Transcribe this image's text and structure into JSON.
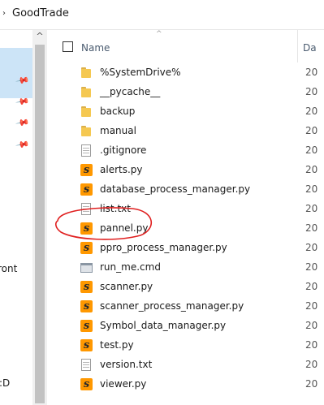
{
  "breadcrumb": {
    "chevron": "›",
    "folder": "GoodTrade"
  },
  "header": {
    "name_label": "Name",
    "date_label": "Da",
    "sort_arrow": "^"
  },
  "nav": {
    "scroll_up": "^",
    "partial_labels": [
      "ront",
      ":D"
    ]
  },
  "files": [
    {
      "name": "%SystemDrive%",
      "type": "folder",
      "date": "20"
    },
    {
      "name": "__pycache__",
      "type": "folder",
      "date": "20"
    },
    {
      "name": "backup",
      "type": "folder",
      "date": "20"
    },
    {
      "name": "manual",
      "type": "folder",
      "date": "20"
    },
    {
      "name": ".gitignore",
      "type": "text",
      "date": "20"
    },
    {
      "name": "alerts.py",
      "type": "python",
      "date": "20"
    },
    {
      "name": "database_process_manager.py",
      "type": "python",
      "date": "20"
    },
    {
      "name": "list.txt",
      "type": "text",
      "date": "20"
    },
    {
      "name": "pannel.py",
      "type": "python",
      "date": "20"
    },
    {
      "name": "ppro_process_manager.py",
      "type": "python",
      "date": "20"
    },
    {
      "name": "run_me.cmd",
      "type": "cmd",
      "date": "20"
    },
    {
      "name": "scanner.py",
      "type": "python",
      "date": "20"
    },
    {
      "name": "scanner_process_manager.py",
      "type": "python",
      "date": "20"
    },
    {
      "name": "Symbol_data_manager.py",
      "type": "python",
      "date": "20"
    },
    {
      "name": "test.py",
      "type": "python",
      "date": "20"
    },
    {
      "name": "version.txt",
      "type": "text",
      "date": "20"
    },
    {
      "name": "viewer.py",
      "type": "python",
      "date": "20"
    }
  ],
  "colors": {
    "annotation": "#e02020",
    "selection": "#cce4f7",
    "folder": "#f5c851",
    "python_icon": "#ff9800"
  }
}
